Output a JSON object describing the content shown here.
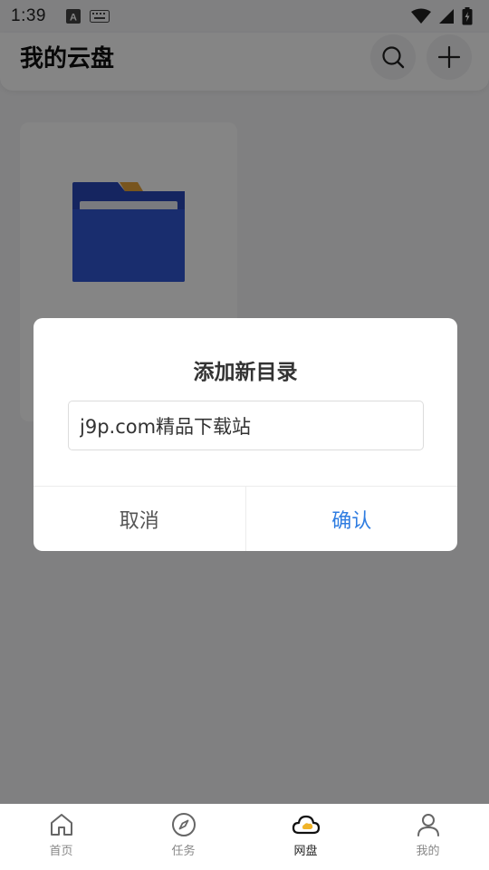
{
  "status_bar": {
    "time": "1:39"
  },
  "header": {
    "title": "我的云盘"
  },
  "dialog": {
    "title": "添加新目录",
    "input_value": "j9p.com精品下载站",
    "cancel_label": "取消",
    "confirm_label": "确认"
  },
  "bottom_nav": {
    "items": [
      {
        "label": "首页",
        "icon": "home-icon"
      },
      {
        "label": "任务",
        "icon": "compass-icon"
      },
      {
        "label": "网盘",
        "icon": "cloud-icon",
        "active": true
      },
      {
        "label": "我的",
        "icon": "person-icon"
      }
    ]
  },
  "colors": {
    "accent": "#2f7de1",
    "folder_blue": "#2c4fc9",
    "overlay": "rgba(0,0,0,0.48)"
  }
}
